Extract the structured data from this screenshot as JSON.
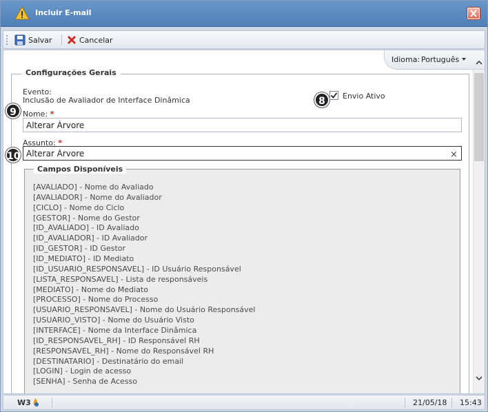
{
  "window": {
    "title": "Incluir E-mail"
  },
  "toolbar": {
    "save_label": "Salvar",
    "cancel_label": "Cancelar"
  },
  "language": {
    "label": "Idioma:",
    "value": "Português"
  },
  "form": {
    "section_title": "Configurações Gerais",
    "event_label": "Evento:",
    "event_value": "Inclusão de Avaliador de Interface Dinâmica",
    "active_label": "Envio Ativo",
    "active_checked": true,
    "name_label": "Nome:",
    "name_value": "Alterar Árvore",
    "subject_label": "Assunto:",
    "subject_value": "Alterar Árvore",
    "required_mark": "*"
  },
  "badges": [
    "8",
    "9",
    "10"
  ],
  "available_fields": {
    "title": "Campos Disponíveis",
    "items": [
      "[AVALIADO] - Nome do Avaliado",
      "[AVALIADOR] - Nome do Avaliador",
      "[CICLO] - Nome do Ciclo",
      "[GESTOR] - Nome do Gestor",
      "[ID_AVALIADO] - ID Avaliado",
      "[ID_AVALIADOR] - ID Avaliador",
      "[ID_GESTOR] - ID Gestor",
      "[ID_MEDIATO] - ID Mediato",
      "[ID_USUARIO_RESPONSAVEL] - ID Usuário Responsável",
      "[LISTA_RESPONSAVEL] - Lista de responsáveis",
      "[MEDIATO] - Nome do Mediato",
      "[PROCESSO] - Nome do Processo",
      "[USUARIO_RESPONSAVEL] - Nome do Usuário Responsável",
      "[USUARIO_VISTO] - Nome do Usuário Visto",
      "[INTERFACE] - Nome da Interface Dinâmica",
      "[ID_RESPONSAVEL_RH] - ID Responsável RH",
      "[RESPONSAVEL_RH] - Nome do Responsável RH",
      "[DESTINATARIO] - Destinatário do email",
      "[LOGIN] - Login de acesso",
      "[SENHA] - Senha de Acesso"
    ]
  },
  "status": {
    "logo": "W3",
    "date": "21/05/18",
    "time": "15:43"
  },
  "colors": {
    "title_bar": "#4d7fb7",
    "required": "#e02020",
    "close": "#e26a55"
  }
}
